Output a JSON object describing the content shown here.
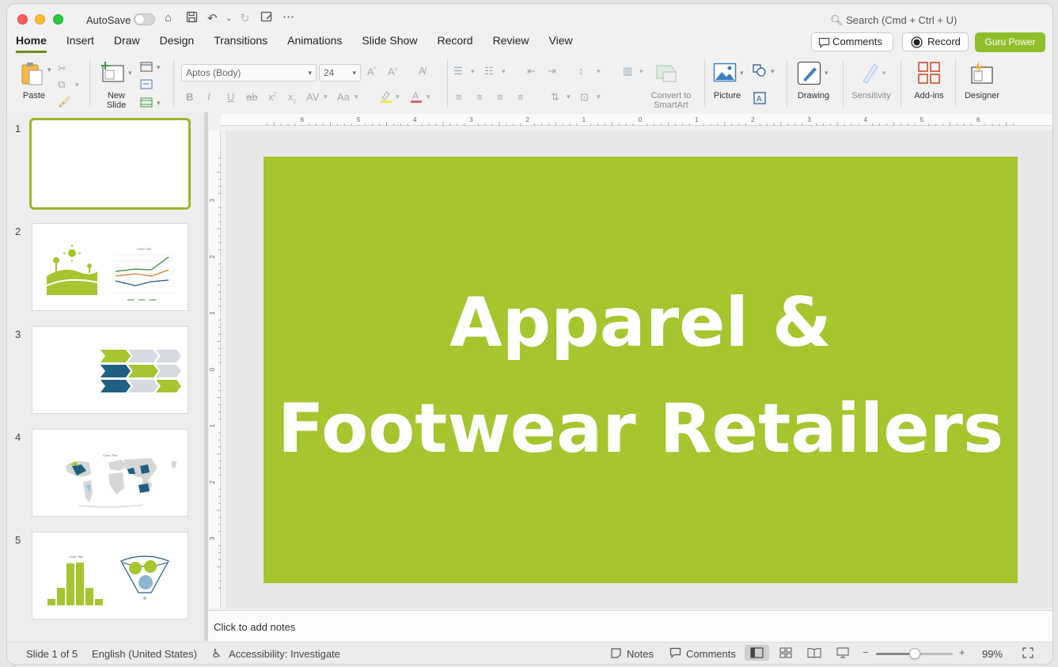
{
  "titlebar": {
    "autosave_label": "AutoSave",
    "search_placeholder": "Search (Cmd + Ctrl + U)"
  },
  "menu": {
    "tabs": [
      "Home",
      "Insert",
      "Draw",
      "Design",
      "Transitions",
      "Animations",
      "Slide Show",
      "Record",
      "Review",
      "View"
    ],
    "active": "Home",
    "comments_label": "Comments",
    "record_label": "Record",
    "guru_label": "Guru Power"
  },
  "ribbon": {
    "paste": "Paste",
    "new_slide_1": "New",
    "new_slide_2": "Slide",
    "font_name": "Aptos (Body)",
    "font_size": "24",
    "convert_1": "Convert to",
    "convert_2": "SmartArt",
    "picture": "Picture",
    "drawing": "Drawing",
    "sensitivity": "Sensitivity",
    "addins": "Add-ins",
    "designer": "Designer"
  },
  "thumbnails": {
    "numbers": [
      "1",
      "2",
      "3",
      "4",
      "5"
    ],
    "chart_title": "Chart Title"
  },
  "rulers": {
    "h_labels": [
      "6",
      "5",
      "4",
      "3",
      "2",
      "1",
      "0",
      "1",
      "2",
      "3",
      "4",
      "5",
      "6"
    ],
    "v_labels": [
      "3",
      "2",
      "1",
      "0",
      "1",
      "2",
      "3"
    ]
  },
  "slide": {
    "title_line1": "Apparel &",
    "title_line2": "Footwear Retailers",
    "bg_color": "#a6c52e"
  },
  "notes": {
    "placeholder": "Click to add notes"
  },
  "status": {
    "slide_of": "Slide 1 of 5",
    "language": "English (United States)",
    "accessibility": "Accessibility: Investigate",
    "notes": "Notes",
    "comments": "Comments",
    "zoom": "99%",
    "zoom_level": 0.5
  },
  "colors": {
    "accent": "#8fbe2a",
    "active_tab": "#6b8f1a",
    "slide_green": "#a6c52e",
    "navy": "#1f5f7f"
  }
}
